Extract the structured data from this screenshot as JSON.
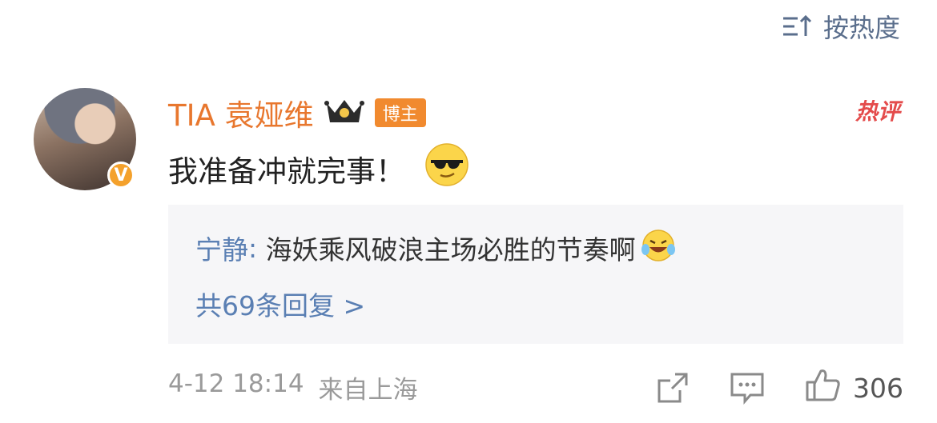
{
  "sort": {
    "label": "按热度",
    "icon": "sort-icon"
  },
  "comment": {
    "username": "TIA 袁娅维",
    "role_badge": "博主",
    "hot_tag": "热评",
    "text": "我准备冲就完事！",
    "emoji": "cool-sunglasses-emoji",
    "verified_badge": "V"
  },
  "reply": {
    "user": "宁静",
    "separator": ": ",
    "text": "海妖乘风破浪主场必胜的节奏啊",
    "emoji": "laugh-cry-emoji",
    "count_label": "共69条回复 >"
  },
  "meta": {
    "timestamp": "4-12 18:14",
    "location": "来自上海"
  },
  "actions": {
    "share_icon": "share-icon",
    "comment_icon": "comment-icon",
    "like_icon": "thumbs-up-icon",
    "like_count": "306"
  },
  "colors": {
    "username": "#e8772e",
    "link": "#5a7fb3",
    "hot": "#e44b4b",
    "badge": "#f18a2f"
  }
}
